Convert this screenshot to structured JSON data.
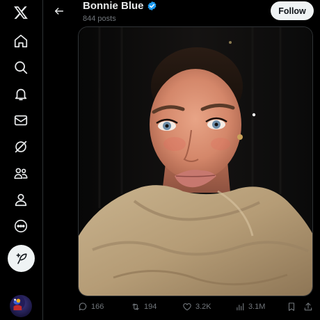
{
  "header": {
    "title": "Bonnie Blue",
    "posts_count": "844 posts",
    "follow_label": "Follow"
  },
  "nav": {
    "items": [
      "x-logo",
      "home-icon",
      "search-icon",
      "bell-icon",
      "mail-icon",
      "grok-icon",
      "communities-icon",
      "profile-icon",
      "more-icon",
      "post-icon"
    ]
  },
  "actions": {
    "replies": "166",
    "reposts": "194",
    "likes": "3.2K",
    "views": "3.1M"
  },
  "colors": {
    "background": "#000000",
    "text": "#e7e9ea",
    "muted": "#71767b",
    "verified": "#1d9bf0",
    "border": "#2f3336"
  }
}
